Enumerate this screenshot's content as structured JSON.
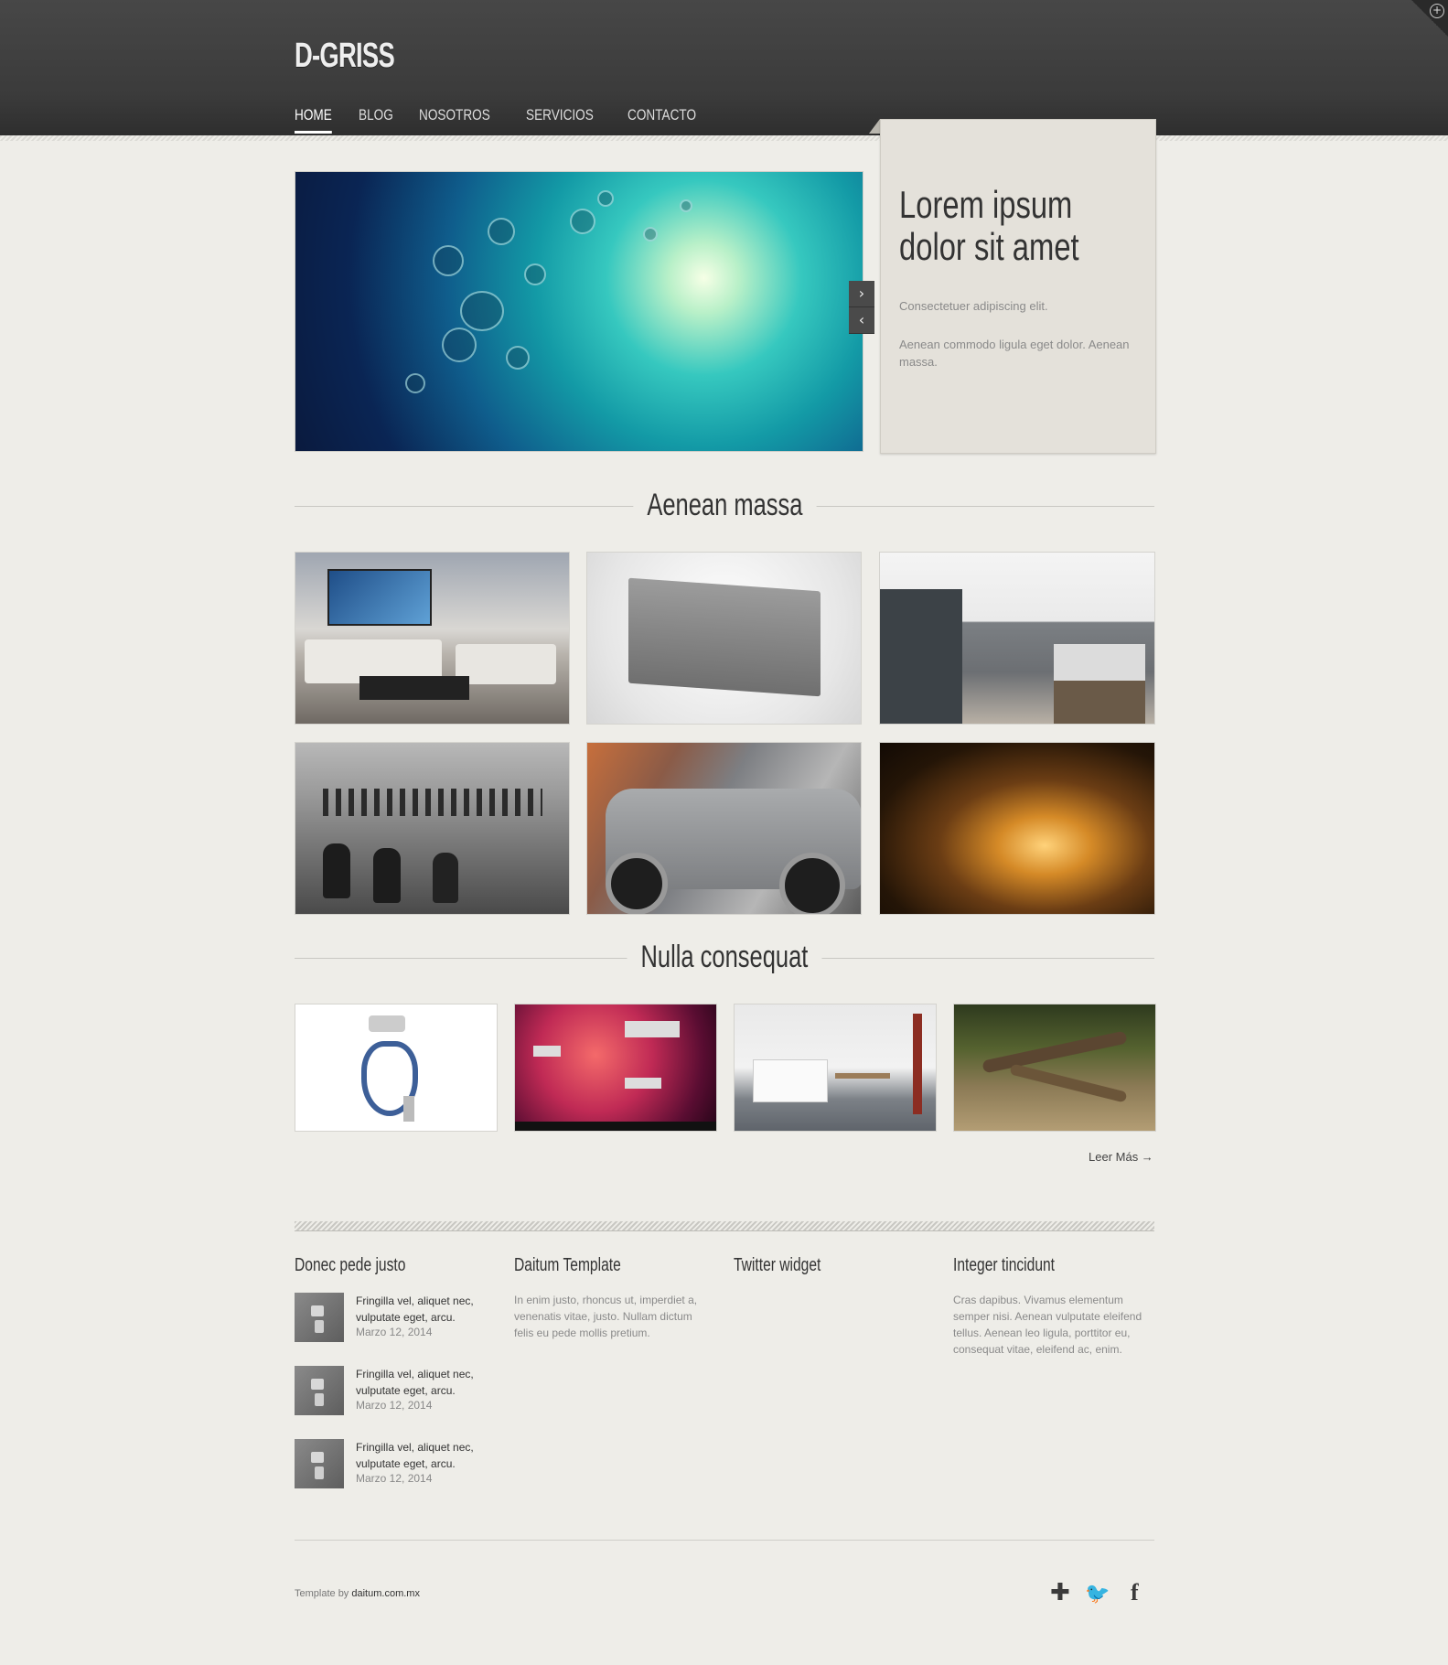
{
  "brand": {
    "logo": "D-GRISS"
  },
  "nav": {
    "items": [
      {
        "label": "HOME",
        "active": true
      },
      {
        "label": "BLOG",
        "active": false
      },
      {
        "label": "NOSOTROS",
        "active": false
      },
      {
        "label": "SERVICIOS",
        "active": false
      },
      {
        "label": "CONTACTO",
        "active": false
      }
    ]
  },
  "slider": {
    "next_icon": "›",
    "prev_icon": "‹"
  },
  "promo": {
    "title": "Lorem ipsum\ndolor sit amet",
    "text1": "Consectetuer adipiscing elit.",
    "text2": "Aenean commodo ligula eget dolor. Aenean massa."
  },
  "sections": {
    "gallery_title": "Aenean massa",
    "projects_title": "Nulla consequat"
  },
  "read_more": "Leer Más →",
  "footer": {
    "col1": {
      "title": "Donec pede justo",
      "posts": [
        {
          "text": "Fringilla vel, aliquet nec, vulputate eget, arcu.",
          "date": "Marzo 12, 2014"
        },
        {
          "text": "Fringilla vel, aliquet nec, vulputate eget, arcu.",
          "date": "Marzo 12, 2014"
        },
        {
          "text": "Fringilla vel, aliquet nec, vulputate eget, arcu.",
          "date": "Marzo 12, 2014"
        }
      ]
    },
    "col2": {
      "title": "Daitum Template",
      "text": "In enim justo, rhoncus ut, imperdiet a, venenatis vitae, justo. Nullam dictum felis eu pede mollis pretium."
    },
    "col3": {
      "title": "Twitter widget"
    },
    "col4": {
      "title": "Integer tincidunt",
      "text": "Cras dapibus. Vivamus elementum semper nisi. Aenean vulputate eleifend tellus. Aenean leo ligula, porttitor eu, consequat vitae, eleifend ac, enim."
    },
    "credit_prefix": "Template by ",
    "credit_link": "daitum.com.mx",
    "social": {
      "plus": "✚",
      "twitter": "🐦",
      "facebook": "f"
    }
  },
  "corner_icon": "+"
}
